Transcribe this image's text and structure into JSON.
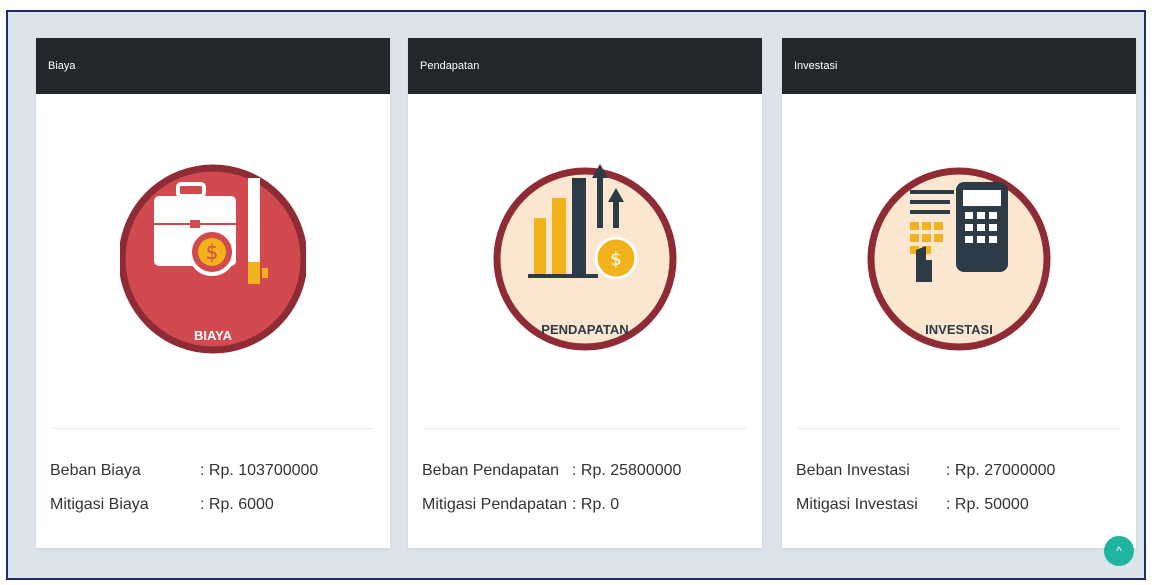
{
  "cards": [
    {
      "title": "Biaya",
      "icon_label": "BIAYA",
      "icon": "briefcase-dollar-icon",
      "rows": [
        {
          "label": "Beban Biaya",
          "value": ": Rp. 103700000"
        },
        {
          "label": "Mitigasi Biaya",
          "value": ": Rp. 6000"
        }
      ]
    },
    {
      "title": "Pendapatan",
      "icon_label": "PENDAPATAN",
      "icon": "bar-chart-dollar-icon",
      "rows": [
        {
          "label": "Beban Pendapatan",
          "value": ": Rp. 25800000"
        },
        {
          "label": "Mitigasi Pendapatan",
          "value": ": Rp. 0"
        }
      ]
    },
    {
      "title": "Investasi",
      "icon_label": "INVESTASI",
      "icon": "calculator-icon",
      "rows": [
        {
          "label": "Beban Investasi",
          "value": ": Rp. 27000000"
        },
        {
          "label": "Mitigasi Investasi",
          "value": ": Rp. 50000"
        }
      ]
    }
  ],
  "scroll_top": {
    "icon": "chevron-up-icon",
    "glyph": "^"
  },
  "colors": {
    "header_bg": "#23272b",
    "ring": "#8e2b35",
    "biaya_fill": "#d04a4f",
    "pale_fill": "#fbe6d0",
    "accent_yellow": "#f2b21c",
    "accent_teal": "#1fb4a0"
  }
}
